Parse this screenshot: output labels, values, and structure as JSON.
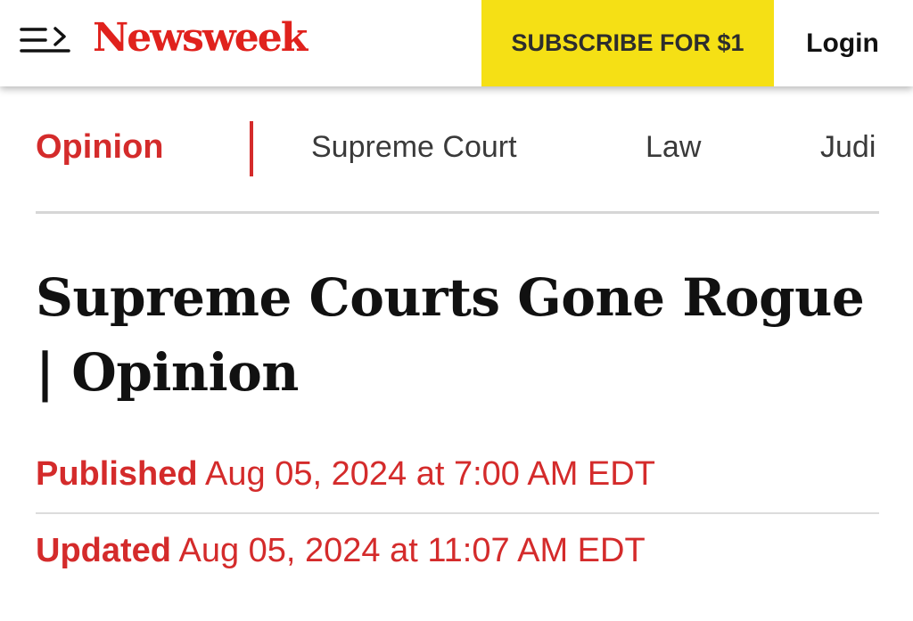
{
  "header": {
    "logo_text": "Newsweek",
    "subscribe_label": "SUBSCRIBE FOR $1",
    "login_label": "Login"
  },
  "topic_nav": {
    "active": "Opinion",
    "items": [
      "Supreme Court",
      "Law",
      "Judi"
    ]
  },
  "article": {
    "headline": "Supreme Courts Gone Rogue | Opinion",
    "published_label": "Published",
    "published_date": "Aug 05, 2024 at 7:00 AM EDT",
    "updated_label": "Updated",
    "updated_date": "Aug 05, 2024 at 11:07 AM EDT"
  },
  "colors": {
    "brand_red": "#e0221d",
    "accent_red": "#d42b2b",
    "subscribe_yellow": "#f5e015"
  },
  "icons": {
    "menu": "menu-arrow-icon"
  }
}
